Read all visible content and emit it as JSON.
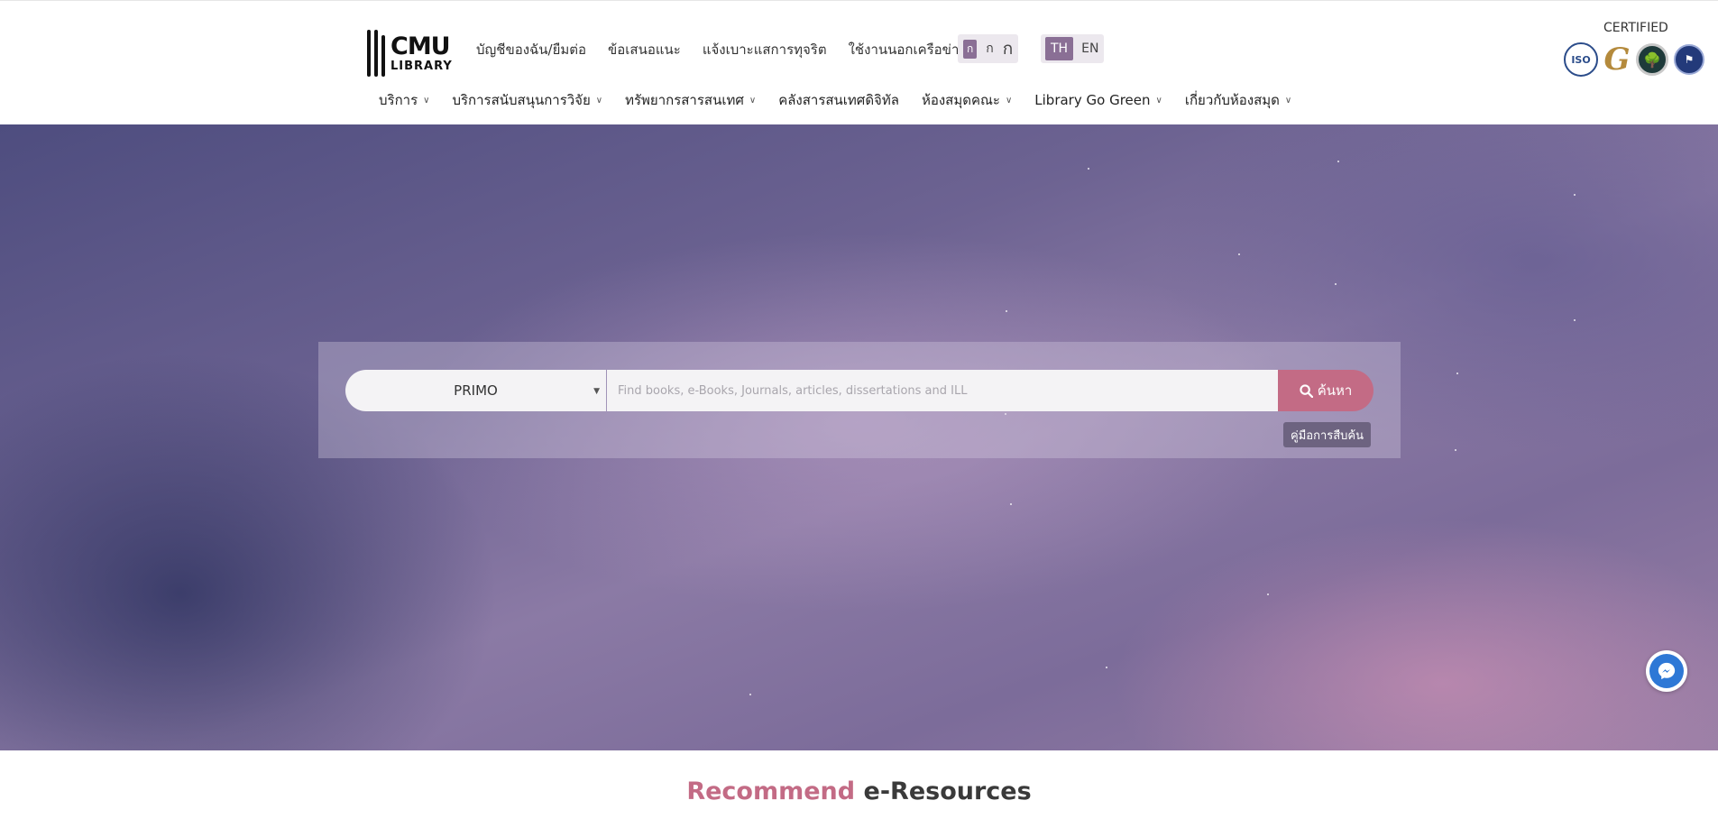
{
  "logo": {
    "line1": "CMU",
    "line2": "LIBRARY"
  },
  "top_links": [
    {
      "label": "บัญชีของฉัน/ยืมต่อ"
    },
    {
      "label": "ข้อเสนอแนะ"
    },
    {
      "label": "แจ้งเบาะแสการทุจริต"
    },
    {
      "label": "ใช้งานนอกเครือข่าย"
    }
  ],
  "font_size": {
    "small": "ก",
    "medium": "ก",
    "large": "ก"
  },
  "language": {
    "active": "TH",
    "inactive": "EN"
  },
  "certified": {
    "label": "CERTIFIED",
    "badges": [
      "ISO",
      "G",
      "",
      ""
    ]
  },
  "main_nav": [
    {
      "label": "บริการ",
      "has_dropdown": "chevron-down-icon"
    },
    {
      "label": "บริการสนับสนุนการวิจัย",
      "has_dropdown": "chevron-down-icon"
    },
    {
      "label": "ทรัพยากรสารสนเทศ",
      "has_dropdown": "chevron-down-icon"
    },
    {
      "label": "คลังสารสนเทศดิจิทัล",
      "has_dropdown": ""
    },
    {
      "label": "ห้องสมุดคณะ",
      "has_dropdown": "chevron-down-icon"
    },
    {
      "label": "Library Go Green",
      "has_dropdown": "chevron-down-icon"
    },
    {
      "label": "เกี่ยวกับห้องสมุด",
      "has_dropdown": "chevron-down-icon"
    }
  ],
  "search": {
    "source_selected": "PRIMO",
    "placeholder": "Find books, e-Books, Journals, articles, dissertations and ILL",
    "value": "",
    "button_label": "ค้นหา",
    "guide_label": "คู่มือการสืบค้น"
  },
  "section": {
    "title_accent": "Recommend",
    "title_rest": "e-Resources"
  },
  "colors": {
    "accent": "#c36b85",
    "toggle_active": "#8a6f95",
    "messenger": "#2e78d6"
  }
}
